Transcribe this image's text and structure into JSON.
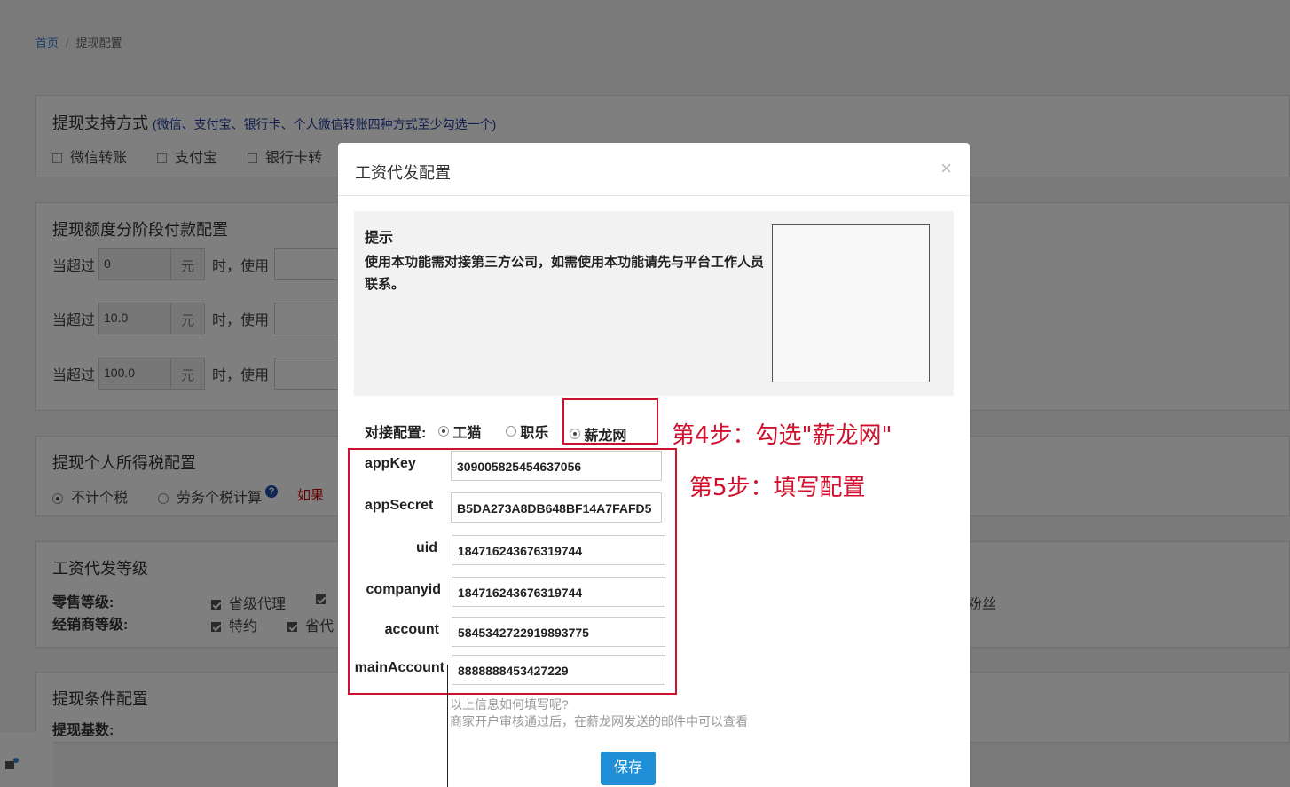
{
  "breadcrumb": {
    "home": "首页",
    "separator": "/",
    "current": "提现配置"
  },
  "withdraw_methods": {
    "title": "提现支持方式",
    "note": "(微信、支付宝、银行卡、个人微信转账四种方式至少勾选一个)",
    "options": [
      "微信转账",
      "支付宝",
      "银行卡转"
    ]
  },
  "tiers": {
    "title": "提现额度分阶段付款配置",
    "prefix": "当超过",
    "unit": "元",
    "suffix": "时，使用",
    "values": [
      "0",
      "10.0",
      "100.0"
    ]
  },
  "tax": {
    "title": "提现个人所得税配置",
    "options": [
      "不计个税",
      "劳务个税计算"
    ],
    "help_glyph": "?",
    "note": "如果"
  },
  "grade": {
    "title": "工资代发等级",
    "retail_label": "零售等级:",
    "retail_options": [
      "省级代理",
      ""
    ],
    "dealer_label": "经销商等级:",
    "dealer_options": [
      "特约",
      "省代"
    ],
    "right_text": "粉丝"
  },
  "condition": {
    "title": "提现条件配置",
    "base_label": "提现基数:"
  },
  "modal": {
    "title": "工资代发配置",
    "close": "×",
    "tip_title": "提示",
    "tip_body": "使用本功能需对接第三方公司，如需使用本功能请先与平台工作人员联系。",
    "conn_label": "对接配置:",
    "conn_options": [
      "工猫",
      "职乐",
      "薪龙网"
    ],
    "fields": [
      {
        "label": "appKey",
        "value": "309005825454637056"
      },
      {
        "label": "appSecret",
        "value": "B5DA273A8DB648BF14A7FAFD5"
      },
      {
        "label": "uid",
        "value": "184716243676319744"
      },
      {
        "label": "companyid",
        "value": "184716243676319744"
      },
      {
        "label": "account",
        "value": "5845342722919893775"
      },
      {
        "label": "mainAccount",
        "value": "8888888453427229"
      }
    ],
    "help_line1": "以上信息如何填写呢?",
    "help_line2": "商家开户审核通过后，在薪龙网发送的邮件中可以查看",
    "save": "保存"
  },
  "annotations": {
    "step4": "第4步：勾选\"薪龙网\"",
    "step5": "第5步：填写配置"
  }
}
